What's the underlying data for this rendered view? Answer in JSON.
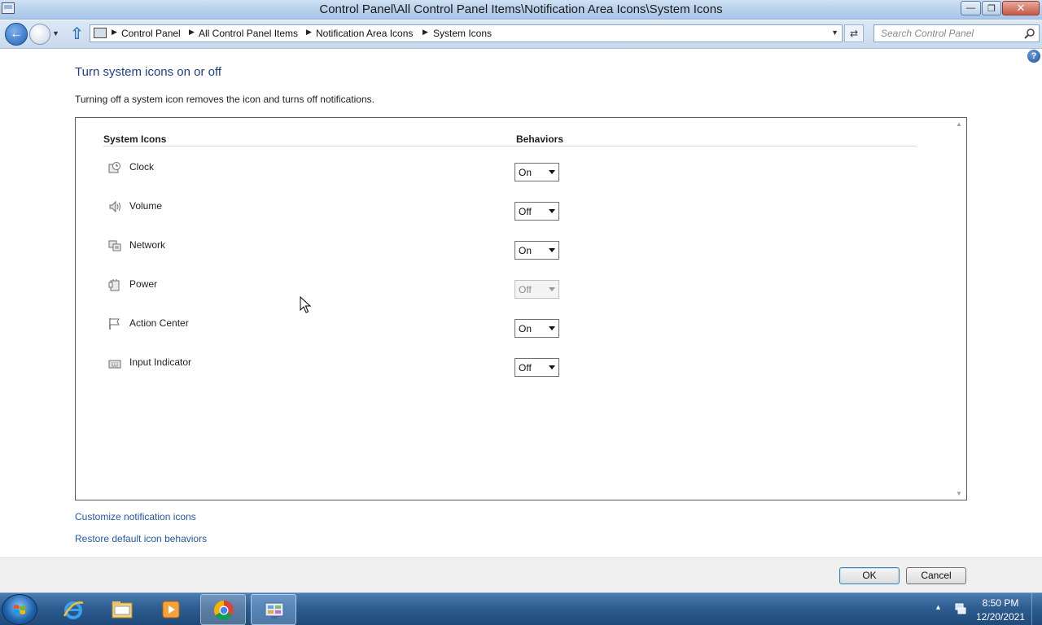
{
  "window": {
    "title": "Control Panel\\All Control Panel Items\\Notification Area Icons\\System Icons"
  },
  "nav": {
    "breadcrumbs": [
      "Control Panel",
      "All Control Panel Items",
      "Notification Area Icons",
      "System Icons"
    ],
    "search_placeholder": "Search Control Panel"
  },
  "content": {
    "title": "Turn system icons on or off",
    "description": "Turning off a system icon removes the icon and turns off notifications.",
    "col_system_icons": "System Icons",
    "col_behaviors": "Behaviors",
    "rows": [
      {
        "label": "Clock",
        "value": "On",
        "icon": "clock-icon",
        "enabled": true
      },
      {
        "label": "Volume",
        "value": "Off",
        "icon": "volume-icon",
        "enabled": true
      },
      {
        "label": "Network",
        "value": "On",
        "icon": "network-icon",
        "enabled": true
      },
      {
        "label": "Power",
        "value": "Off",
        "icon": "power-icon",
        "enabled": false
      },
      {
        "label": "Action Center",
        "value": "On",
        "icon": "action-center-flag-icon",
        "enabled": true
      },
      {
        "label": "Input Indicator",
        "value": "Off",
        "icon": "keyboard-icon",
        "enabled": true
      }
    ],
    "link_customize": "Customize notification icons",
    "link_restore": "Restore default icon behaviors"
  },
  "buttons": {
    "ok": "OK",
    "cancel": "Cancel"
  },
  "taskbar": {
    "time": "8:50 PM",
    "date": "12/20/2021",
    "items": [
      "internet-explorer-icon",
      "windows-explorer-icon",
      "media-player-icon",
      "chrome-icon",
      "control-panel-icon"
    ]
  },
  "colors": {
    "title_blue": "#1e3f8a",
    "link_blue": "#1f5aa6",
    "taskbar": "#2d5d91"
  }
}
